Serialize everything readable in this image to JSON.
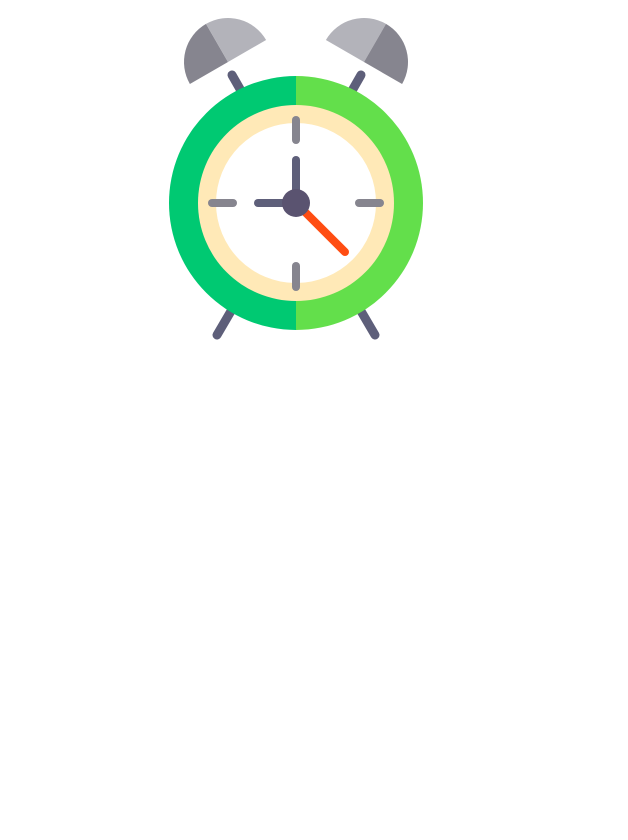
{
  "illustration": {
    "icon": "alarm-clock-icon",
    "time_shown": {
      "hour": 12,
      "minute": 22
    },
    "colors": {
      "bell_light": "#b3b3ba",
      "bell_dark": "#86858f",
      "stem": "#5e5f7a",
      "ring_left": "#00c972",
      "ring_right": "#63df4b",
      "dial_rim": "#ffe9b7",
      "dial_face": "#ffffff",
      "tick": "#86858f",
      "hour_hand": "#5e5f7a",
      "minute_hand": "#ff4d12",
      "hub": "#5a5370",
      "legs": "#5e5f7a",
      "background": "#ffffff"
    }
  }
}
